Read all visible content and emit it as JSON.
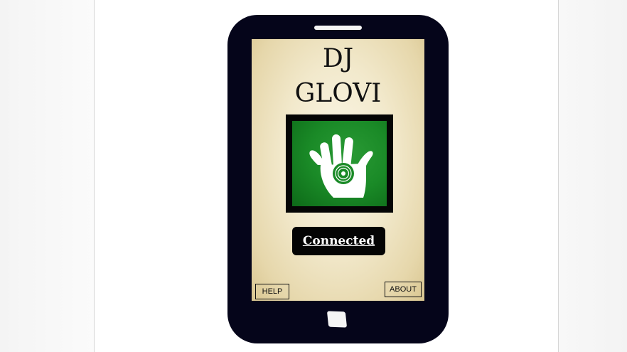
{
  "app": {
    "title_line1": "DJ",
    "title_line2": "GLOVI"
  },
  "logo": {
    "icon": "hand-with-vinyl-icon",
    "background_color": "#1a8a27",
    "frame_color": "#050505"
  },
  "status": {
    "label": "Connected"
  },
  "buttons": {
    "help_label": "HELP",
    "about_label": "ABOUT"
  },
  "colors": {
    "phone_body": "#05051a",
    "screen_background": "#f2e9cc",
    "status_background": "#040404"
  }
}
